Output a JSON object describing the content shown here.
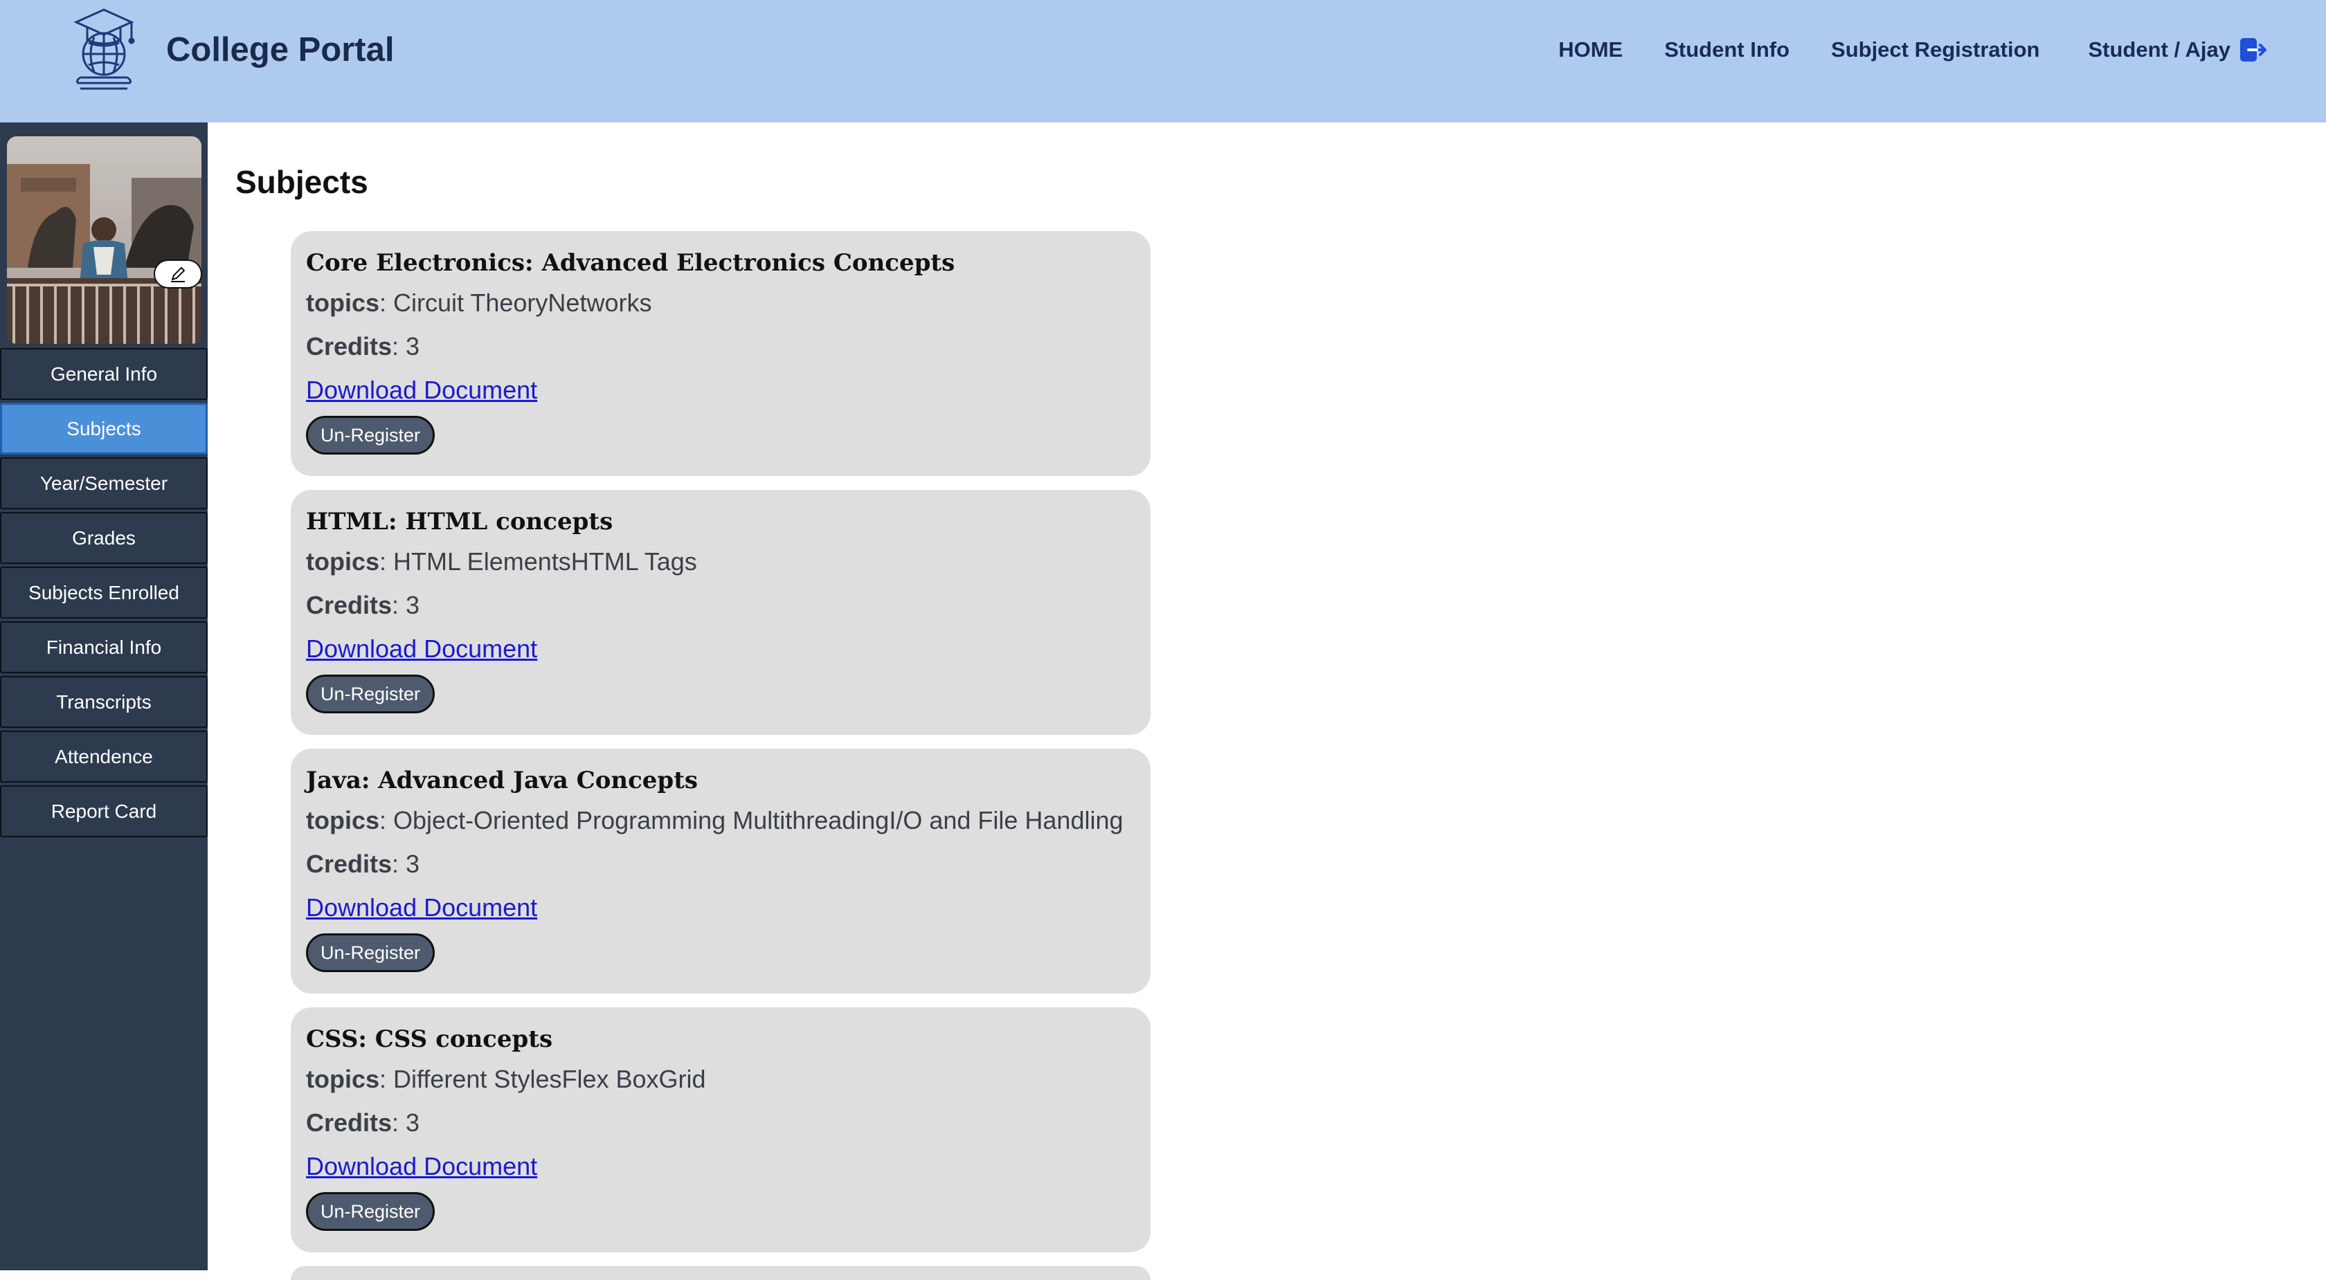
{
  "header": {
    "brand": "College Portal",
    "logo_icon": "graduation-globe-logo",
    "nav": [
      "HOME",
      "Student Info",
      "Subject Registration"
    ],
    "user": "Student / Ajay",
    "logout_icon": "logout-icon",
    "background": "#aecbef"
  },
  "sidebar": {
    "avatar_edit_icon": "pencil-icon",
    "items": [
      {
        "label": "General Info"
      },
      {
        "label": "Subjects"
      },
      {
        "label": "Year/Semester"
      },
      {
        "label": "Grades"
      },
      {
        "label": "Subjects Enrolled"
      },
      {
        "label": "Financial Info"
      },
      {
        "label": "Transcripts"
      },
      {
        "label": "Attendence"
      },
      {
        "label": "Report Card"
      }
    ],
    "active": "Subjects",
    "background": "#2e3a4e",
    "active_color": "#4a90d9"
  },
  "main": {
    "title": "Subjects",
    "topics_label": "topics",
    "credits_label": "Credits",
    "subjects": [
      {
        "name": "Core Electronics: Advanced Electronics Concepts",
        "topics": ": Circuit TheoryNetworks",
        "credits": ": 3",
        "link": "Download Document",
        "button": "Un-Register"
      },
      {
        "name": "HTML: HTML concepts",
        "topics": ": HTML ElementsHTML Tags",
        "credits": ": 3",
        "link": "Download Document",
        "button": "Un-Register"
      },
      {
        "name": "Java: Advanced Java Concepts",
        "topics": ": Object-Oriented Programming MultithreadingI/O and File Handling",
        "credits": ": 3",
        "link": "Download Document",
        "button": "Un-Register"
      },
      {
        "name": "CSS: CSS concepts",
        "topics": ": Different StylesFlex BoxGrid",
        "credits": ": 3",
        "link": "Download Document",
        "button": "Un-Register"
      }
    ]
  }
}
